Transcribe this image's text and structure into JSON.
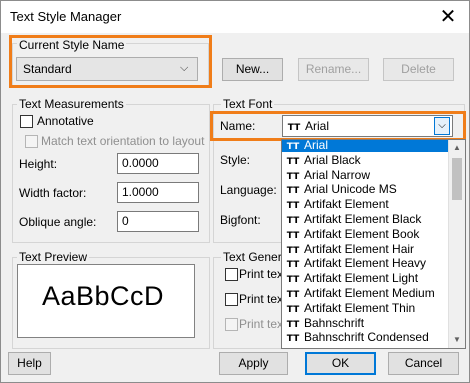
{
  "window": {
    "title": "Text Style Manager",
    "close_glyph": "✕"
  },
  "current_style": {
    "label": "Current Style Name",
    "value": "Standard"
  },
  "buttons": {
    "new": "New...",
    "rename": "Rename...",
    "delete": "Delete",
    "help": "Help",
    "apply": "Apply",
    "ok": "OK",
    "cancel": "Cancel"
  },
  "measurements": {
    "label": "Text Measurements",
    "annotative": "Annotative",
    "match_orientation": "Match text orientation to layout",
    "height_label": "Height:",
    "height_value": "0.0000",
    "width_label": "Width factor:",
    "width_value": "1.0000",
    "oblique_label": "Oblique angle:",
    "oblique_value": "0"
  },
  "font": {
    "label": "Text Font",
    "name_label": "Name:",
    "name_value": "Arial",
    "style_label": "Style:",
    "language_label": "Language:",
    "bigfont_label": "Bigfont:",
    "list": [
      "Arial",
      "Arial Black",
      "Arial Narrow",
      "Arial Unicode MS",
      "Artifakt Element",
      "Artifakt Element Black",
      "Artifakt Element Book",
      "Artifakt Element Hair",
      "Artifakt Element Heavy",
      "Artifakt Element Light",
      "Artifakt Element Medium",
      "Artifakt Element Thin",
      "Bahnschrift",
      "Bahnschrift Condensed"
    ],
    "selected_index": 0
  },
  "preview": {
    "label": "Text Preview",
    "sample": "AaBbCcD"
  },
  "generation": {
    "label": "Text Genera",
    "opt1": "Print text",
    "opt2": "Print text",
    "opt3": "Print text"
  },
  "icons": {
    "font_item": "truetype-font-icon",
    "dropdown": "chevron-down-icon"
  },
  "colors": {
    "highlight": "#f07d19",
    "selection": "#0078d7"
  }
}
